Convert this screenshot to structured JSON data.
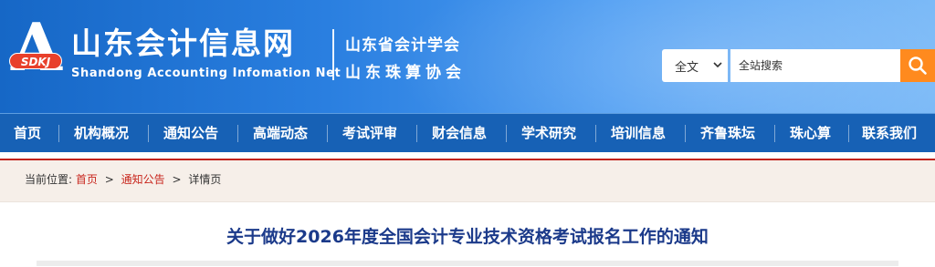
{
  "header": {
    "logo": {
      "letter": "A",
      "badge": "SDKJ"
    },
    "site_title": "山东会计信息网",
    "site_subtitle": "Shandong Accounting Infomation Net",
    "association_1": "山东省会计学会",
    "association_2": "山东珠算协会",
    "gradient_colors": [
      "#1667c6",
      "#78b8f7"
    ]
  },
  "search": {
    "scope_selected": "全文",
    "placeholder": "全站搜索",
    "button_color": "#ff8a1e",
    "button_icon": "search-icon"
  },
  "nav": {
    "background": "#1761b5",
    "items": [
      "首页",
      "机构概况",
      "通知公告",
      "高端动态",
      "考试评审",
      "财会信息",
      "学术研究",
      "培训信息",
      "齐鲁珠坛",
      "珠心算",
      "联系我们"
    ]
  },
  "breadcrumb": {
    "prefix": "当前位置:",
    "items": [
      "首页",
      "通知公告",
      "详情页"
    ],
    "separator": ">",
    "link_color": "#c8261d"
  },
  "article": {
    "title": "关于做好2026年度全国会计专业技术资格考试报名工作的通知",
    "title_color": "#1b3a8a"
  }
}
